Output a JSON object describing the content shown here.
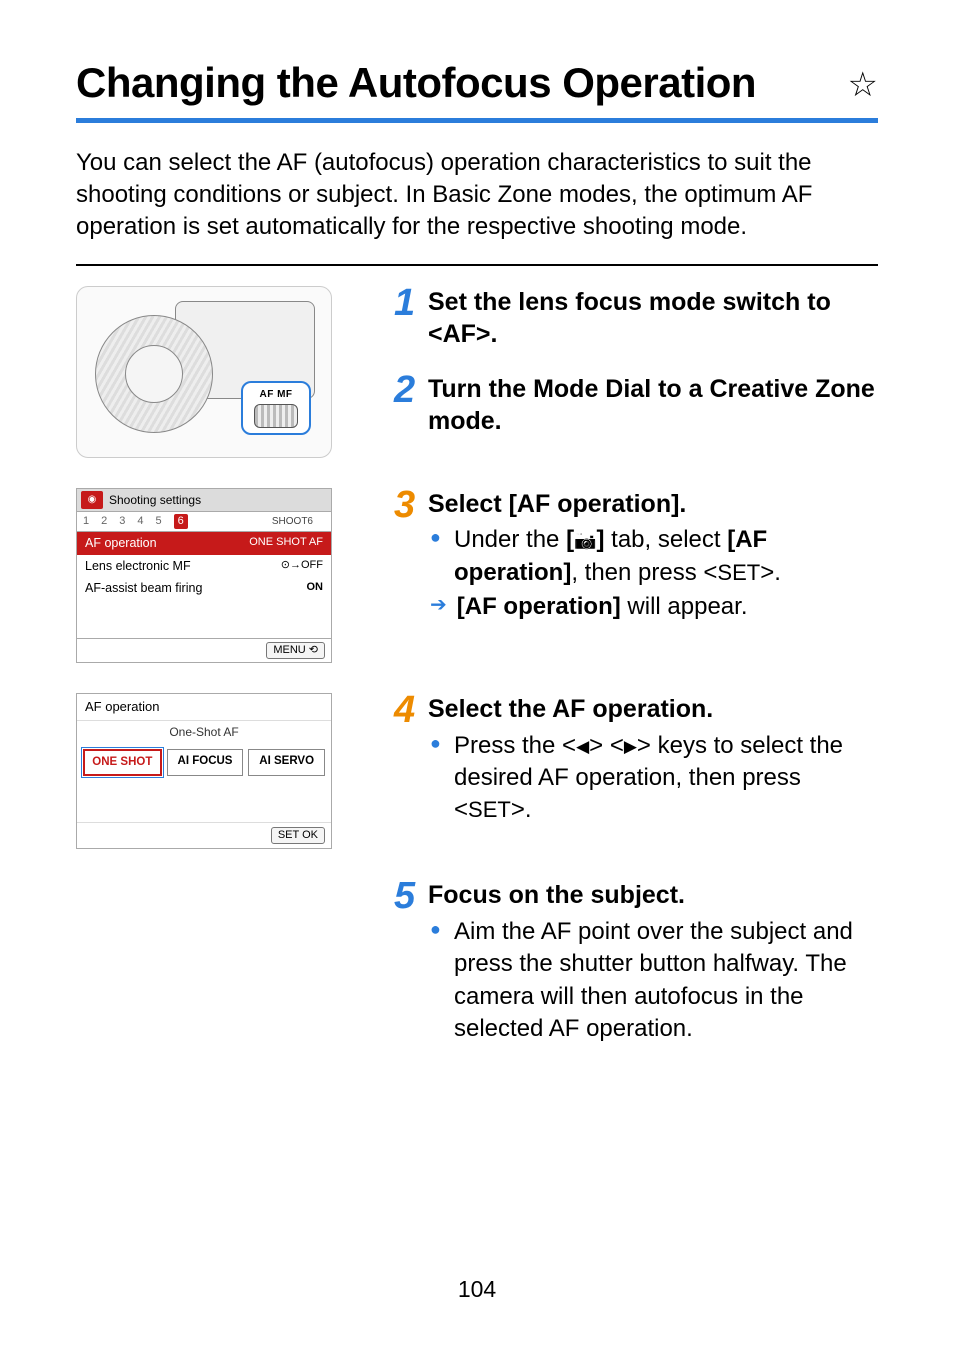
{
  "title": "Changing the Autofocus Operation",
  "intro": "You can select the AF (autofocus) operation characteristics to suit the shooting conditions or subject. In Basic Zone modes, the optimum AF operation is set automatically for the respective shooting mode.",
  "illustration": {
    "switch_label": "AF  MF"
  },
  "menu1": {
    "head_title": "Shooting settings",
    "tabs": [
      "1",
      "2",
      "3",
      "4",
      "5",
      "6"
    ],
    "active_tab_index": 5,
    "tab_right_label": "SHOOT6",
    "rows": [
      {
        "label": "AF operation",
        "value": "ONE SHOT AF",
        "highlight": true
      },
      {
        "label": "Lens electronic MF",
        "value": "⊙→OFF",
        "highlight": false
      },
      {
        "label": "AF-assist beam firing",
        "value": "ON",
        "highlight": false
      }
    ],
    "footer_button": "MENU ⟲"
  },
  "menu2": {
    "title": "AF operation",
    "subtitle": "One-Shot AF",
    "options": [
      "ONE SHOT",
      "AI FOCUS",
      "AI SERVO"
    ],
    "selected_index": 0,
    "footer_button": "SET  OK"
  },
  "steps": {
    "s1": {
      "num": "1",
      "color": "blue",
      "head": "Set the lens focus mode switch to <AF>."
    },
    "s2": {
      "num": "2",
      "color": "blue",
      "head": "Turn the Mode Dial to a Creative Zone mode."
    },
    "s3": {
      "num": "3",
      "color": "orange",
      "head": "Select [AF operation].",
      "b1_pre": "Under the ",
      "b1_mid_bold": "[",
      "b1_mid_bold2": "]",
      "b1_mid": " tab, select ",
      "b1_bold2": "[AF operation]",
      "b1_post": ", then press <",
      "b1_key": "SET",
      "b1_end": ">.",
      "b2_bold": "[AF operation]",
      "b2_post": " will appear."
    },
    "s4": {
      "num": "4",
      "color": "orange",
      "head": "Select the AF operation.",
      "b1_pre": "Press the <",
      "b1_mid1": "> <",
      "b1_mid2": "> keys to select the desired AF operation, then press <",
      "b1_key": "SET",
      "b1_end": ">."
    },
    "s5": {
      "num": "5",
      "color": "blue",
      "head": "Focus on the subject.",
      "b1": "Aim the AF point over the subject and press the shutter button halfway. The camera will then autofocus in the selected AF operation."
    }
  },
  "page_number": "104"
}
